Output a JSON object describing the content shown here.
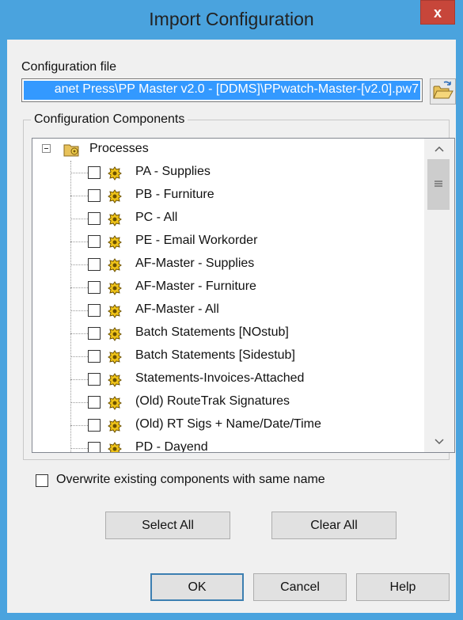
{
  "window": {
    "title": "Import Configuration",
    "close_glyph": "x"
  },
  "file": {
    "label": "Configuration file",
    "value": "anet Press\\PP Master v2.0 - [DDMS]\\PPwatch-Master-[v2.0].pw7",
    "browse_icon": "open-folder-icon"
  },
  "components": {
    "legend": "Configuration Components",
    "root": "Processes",
    "items": [
      {
        "label": "PA - Supplies",
        "checked": false
      },
      {
        "label": "PB - Furniture",
        "checked": false
      },
      {
        "label": "PC - All",
        "checked": false
      },
      {
        "label": "PE - Email Workorder",
        "checked": false
      },
      {
        "label": "AF-Master - Supplies",
        "checked": false
      },
      {
        "label": "AF-Master - Furniture",
        "checked": false
      },
      {
        "label": "AF-Master - All",
        "checked": false
      },
      {
        "label": "Batch Statements [NOstub]",
        "checked": false
      },
      {
        "label": "Batch Statements [Sidestub]",
        "checked": false
      },
      {
        "label": "Statements-Invoices-Attached",
        "checked": false
      },
      {
        "label": "(Old) RouteTrak Signatures",
        "checked": false
      },
      {
        "label": "(Old) RT Sigs + Name/Date/Time",
        "checked": false
      },
      {
        "label": "PD - Dayend",
        "checked": false
      }
    ]
  },
  "overwrite": {
    "label": "Overwrite existing components with same name",
    "checked": false
  },
  "buttons": {
    "select_all": "Select All",
    "clear_all": "Clear All",
    "ok": "OK",
    "cancel": "Cancel",
    "help": "Help"
  },
  "colors": {
    "titlebar": "#4aa3de",
    "close": "#c7463a",
    "selection": "#3399ff",
    "dialog": "#f0f0f0"
  }
}
